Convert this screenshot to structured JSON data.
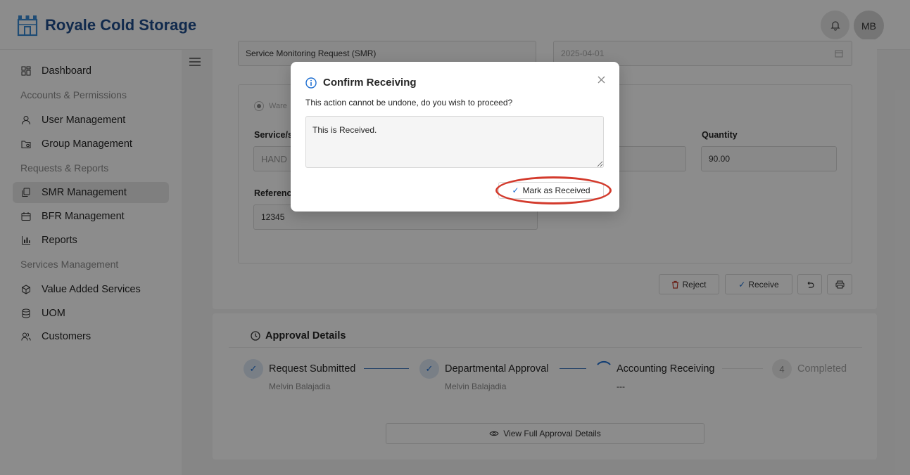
{
  "brand": {
    "name": "Royale Cold Storage",
    "logo_icon": "building-logo-icon",
    "color": "#1f4e8c"
  },
  "header": {
    "avatar_initials": "MB"
  },
  "sidebar": {
    "items": [
      {
        "label": "Dashboard",
        "icon": "dashboard-icon"
      },
      {
        "label": "Accounts & Permissions",
        "type": "group"
      },
      {
        "label": "User Management",
        "icon": "user-icon"
      },
      {
        "label": "Group Management",
        "icon": "folder-group-icon"
      },
      {
        "label": "Requests & Reports",
        "type": "group"
      },
      {
        "label": "SMR Management",
        "icon": "copy-icon",
        "active": true
      },
      {
        "label": "BFR Management",
        "icon": "calendar-icon"
      },
      {
        "label": "Reports",
        "icon": "bar-chart-icon"
      },
      {
        "label": "Services Management",
        "type": "group"
      },
      {
        "label": "Value Added Services",
        "icon": "box-icon"
      },
      {
        "label": "UOM",
        "icon": "database-icon"
      },
      {
        "label": "Customers",
        "icon": "users-icon"
      }
    ]
  },
  "form": {
    "request_type": "Service Monitoring Request (SMR)",
    "date": "2025-04-01",
    "radio_label": "Ware",
    "service_label": "Service/s",
    "service_value": "HAND",
    "quantity_label": "Quantity",
    "quantity_value": "90.00",
    "reference_label": "Referenc",
    "reference_value": "12345"
  },
  "actions": {
    "reject": "Reject",
    "receive": "Receive"
  },
  "approval": {
    "title": "Approval Details",
    "steps": [
      {
        "title": "Request Submitted",
        "sub": "Melvin Balajadia",
        "status": "done"
      },
      {
        "title": "Departmental Approval",
        "sub": "Melvin Balajadia",
        "status": "done"
      },
      {
        "title": "Accounting Receiving",
        "sub": "---",
        "status": "in-progress"
      },
      {
        "title": "Completed",
        "sub": "",
        "status": "pending",
        "number": "4"
      }
    ],
    "view_full": "View Full Approval Details"
  },
  "modal": {
    "title": "Confirm Receiving",
    "message": "This action cannot be undone, do you wish to proceed?",
    "textarea_value": "This is Received.",
    "confirm_label": "Mark as Received"
  }
}
